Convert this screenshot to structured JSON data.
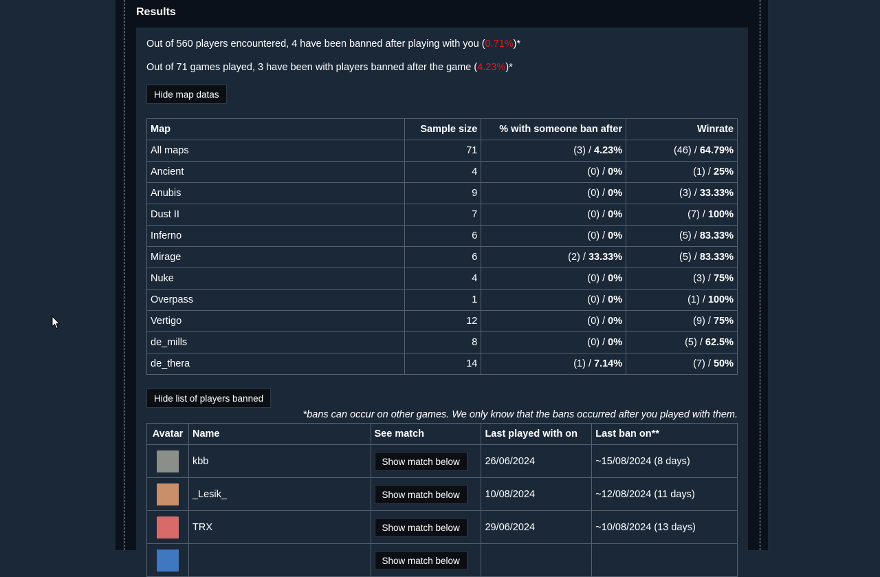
{
  "results": {
    "title": "Results",
    "stat1_prefix": "Out of 560 players encountered, 4 have been banned after playing with you (",
    "stat1_value": "0.71%",
    "stat1_suffix": ")*",
    "stat2_prefix": "Out of 71 games played, 3 have been with players banned after the game (",
    "stat2_value": "4.23%",
    "stat2_suffix": ")*"
  },
  "buttons": {
    "hide_map": "Hide map datas",
    "hide_players": "Hide list of players banned",
    "show_match": "Show match below"
  },
  "map_table": {
    "headers": [
      "Map",
      "Sample size",
      "% with someone ban after",
      "Winrate"
    ],
    "rows": [
      {
        "map": "All maps",
        "sample": "71",
        "ban_count": "(3) / ",
        "ban_pct": "4.23%",
        "win_count": "(46) / ",
        "win_pct": "64.79%"
      },
      {
        "map": "Ancient",
        "sample": "4",
        "ban_count": "(0) / ",
        "ban_pct": "0%",
        "win_count": "(1) / ",
        "win_pct": "25%"
      },
      {
        "map": "Anubis",
        "sample": "9",
        "ban_count": "(0) / ",
        "ban_pct": "0%",
        "win_count": "(3) / ",
        "win_pct": "33.33%"
      },
      {
        "map": "Dust II",
        "sample": "7",
        "ban_count": "(0) / ",
        "ban_pct": "0%",
        "win_count": "(7) / ",
        "win_pct": "100%"
      },
      {
        "map": "Inferno",
        "sample": "6",
        "ban_count": "(0) / ",
        "ban_pct": "0%",
        "win_count": "(5) / ",
        "win_pct": "83.33%"
      },
      {
        "map": "Mirage",
        "sample": "6",
        "ban_count": "(2) / ",
        "ban_pct": "33.33%",
        "win_count": "(5) / ",
        "win_pct": "83.33%"
      },
      {
        "map": "Nuke",
        "sample": "4",
        "ban_count": "(0) / ",
        "ban_pct": "0%",
        "win_count": "(3) / ",
        "win_pct": "75%"
      },
      {
        "map": "Overpass",
        "sample": "1",
        "ban_count": "(0) / ",
        "ban_pct": "0%",
        "win_count": "(1) / ",
        "win_pct": "100%"
      },
      {
        "map": "Vertigo",
        "sample": "12",
        "ban_count": "(0) / ",
        "ban_pct": "0%",
        "win_count": "(9) / ",
        "win_pct": "75%"
      },
      {
        "map": "de_mills",
        "sample": "8",
        "ban_count": "(0) / ",
        "ban_pct": "0%",
        "win_count": "(5) / ",
        "win_pct": "62.5%"
      },
      {
        "map": "de_thera",
        "sample": "14",
        "ban_count": "(1) / ",
        "ban_pct": "7.14%",
        "win_count": "(7) / ",
        "win_pct": "50%"
      }
    ]
  },
  "note": "*bans can occur on other games. We only know that the bans occurred after you played with them.",
  "players_table": {
    "headers": [
      "Avatar",
      "Name",
      "See match",
      "Last played with on",
      "Last ban on**"
    ],
    "rows": [
      {
        "name": "kbb",
        "last_played": "26/06/2024",
        "last_ban": "~15/08/2024 (8 days)",
        "avatar_color": "#8a8f8a"
      },
      {
        "name": "_Lesik_",
        "last_played": "10/08/2024",
        "last_ban": "~12/08/2024 (11 days)",
        "avatar_color": "#c98f6a"
      },
      {
        "name": "TRX",
        "last_played": "29/06/2024",
        "last_ban": "~10/08/2024 (13 days)",
        "avatar_color": "#d96a6a"
      },
      {
        "name": "",
        "last_played": "",
        "last_ban": "",
        "avatar_color": "#3f78c0"
      }
    ]
  }
}
